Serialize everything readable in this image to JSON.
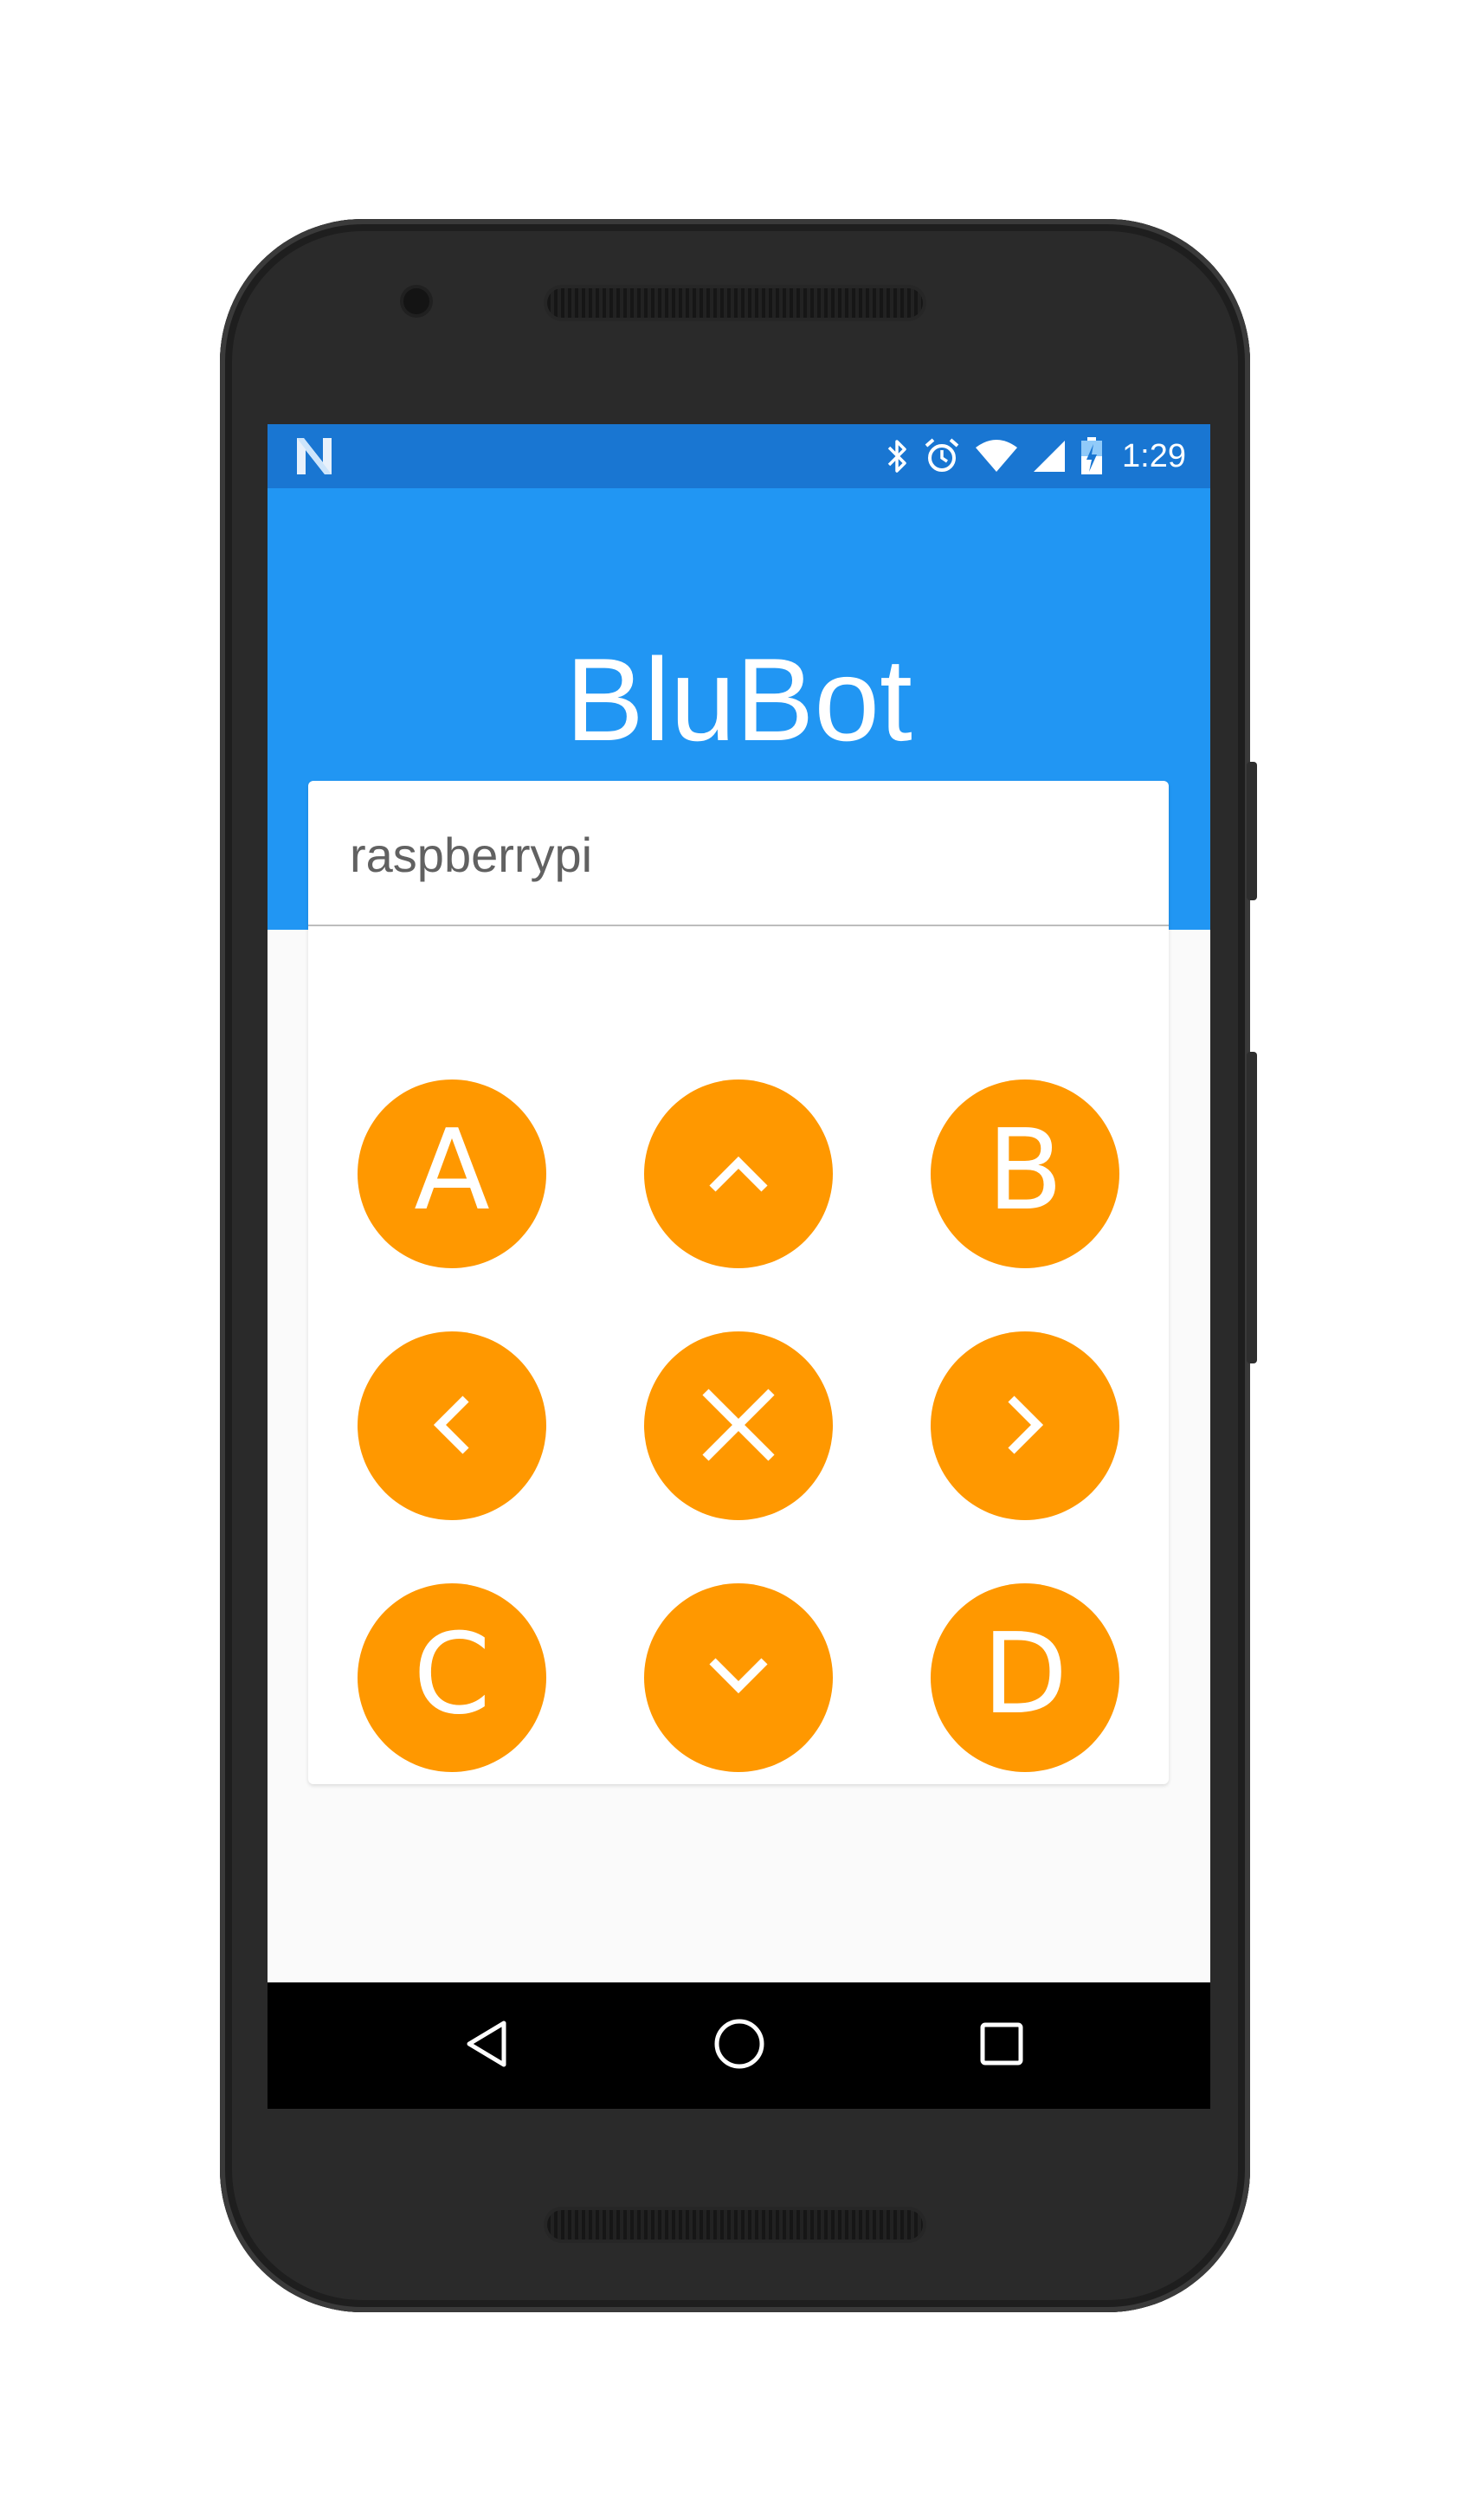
{
  "status_bar": {
    "time": "1:29",
    "icons": [
      "notification-n-icon",
      "bluetooth-icon",
      "alarm-icon",
      "wifi-icon",
      "signal-icon",
      "battery-charging-icon"
    ]
  },
  "app": {
    "title": "BluBot"
  },
  "device": {
    "value": "raspberrypi"
  },
  "pad": {
    "a_label": "A",
    "b_label": "B",
    "c_label": "C",
    "d_label": "D"
  },
  "colors": {
    "status_bar": "#1976d2",
    "app_bar": "#2196f3",
    "button": "#ff9800"
  },
  "nav": {
    "icons": [
      "back-icon",
      "home-icon",
      "recents-icon"
    ]
  }
}
